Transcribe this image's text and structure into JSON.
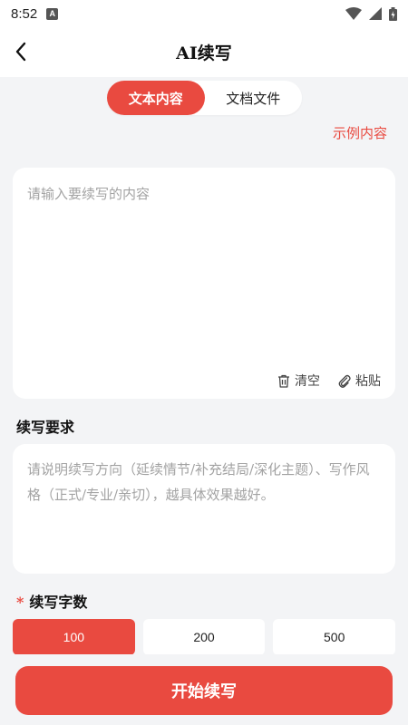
{
  "status_bar": {
    "time": "8:52",
    "badge": "A",
    "icons": [
      "wifi-icon",
      "signal-icon",
      "battery-icon"
    ]
  },
  "header": {
    "title": "AI续写",
    "back_icon": "chevron-left-icon"
  },
  "tabs": [
    {
      "label": "文本内容",
      "active": true
    },
    {
      "label": "文档文件",
      "active": false
    }
  ],
  "example_link": "示例内容",
  "content": {
    "placeholder": "请输入要续写的内容",
    "clear_label": "清空",
    "paste_label": "粘贴"
  },
  "requirements": {
    "label": "续写要求",
    "placeholder": "请说明续写方向（延续情节/补充结局/深化主题）、写作风格（正式/专业/亲切），越具体效果越好。"
  },
  "word_count": {
    "required_mark": "*",
    "label": "续写字数",
    "options": [
      "100",
      "200",
      "500"
    ],
    "selected": "100"
  },
  "start_button": "开始续写",
  "colors": {
    "accent": "#e94a40",
    "background": "#f3f4f6",
    "card": "#ffffff"
  }
}
